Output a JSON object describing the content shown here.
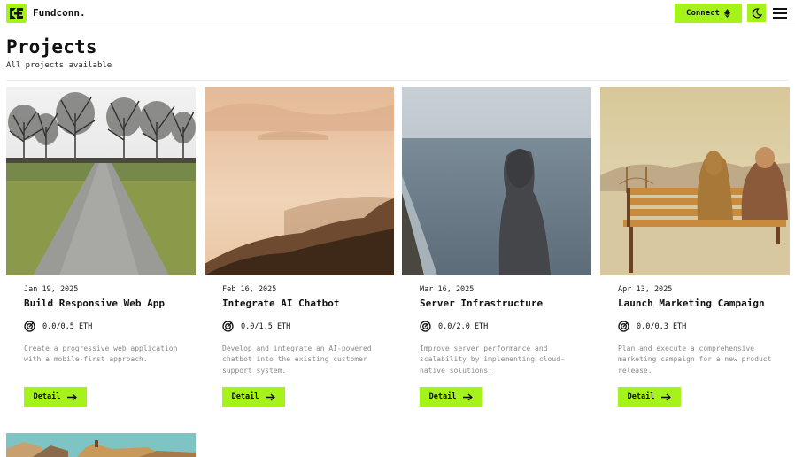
{
  "header": {
    "brand": "Fundconn.",
    "connect_label": "Connect"
  },
  "page": {
    "title": "Projects",
    "subtitle": "All projects available"
  },
  "projects": [
    {
      "date": "Jan 19, 2025",
      "title": "Build Responsive Web App",
      "funding": "0.0/0.5 ETH",
      "description": "Create a progressive web application with a mobile-first approach.",
      "button": "Detail"
    },
    {
      "date": "Feb 16, 2025",
      "title": "Integrate AI Chatbot",
      "funding": "0.0/1.5 ETH",
      "description": "Develop and integrate an AI-powered chatbot into the existing customer support system.",
      "button": "Detail"
    },
    {
      "date": "Mar 16, 2025",
      "title": "Server Infrastructure",
      "funding": "0.0/2.0 ETH",
      "description": "Improve server performance and scalability by implementing cloud-native solutions.",
      "button": "Detail"
    },
    {
      "date": "Apr 13, 2025",
      "title": "Launch Marketing Campaign",
      "funding": "0.0/0.3 ETH",
      "description": "Plan and execute a comprehensive marketing campaign for a new product release.",
      "button": "Detail"
    }
  ],
  "colors": {
    "accent": "#a6f21b",
    "text": "#111111",
    "muted": "#8a8a8a"
  },
  "icons": {
    "logo": "fundconn-logo-icon",
    "connect": "ethereum-icon",
    "theme": "moon-icon",
    "menu": "hamburger-menu-icon",
    "funding": "target-icon",
    "detail": "arrow-right-icon"
  }
}
